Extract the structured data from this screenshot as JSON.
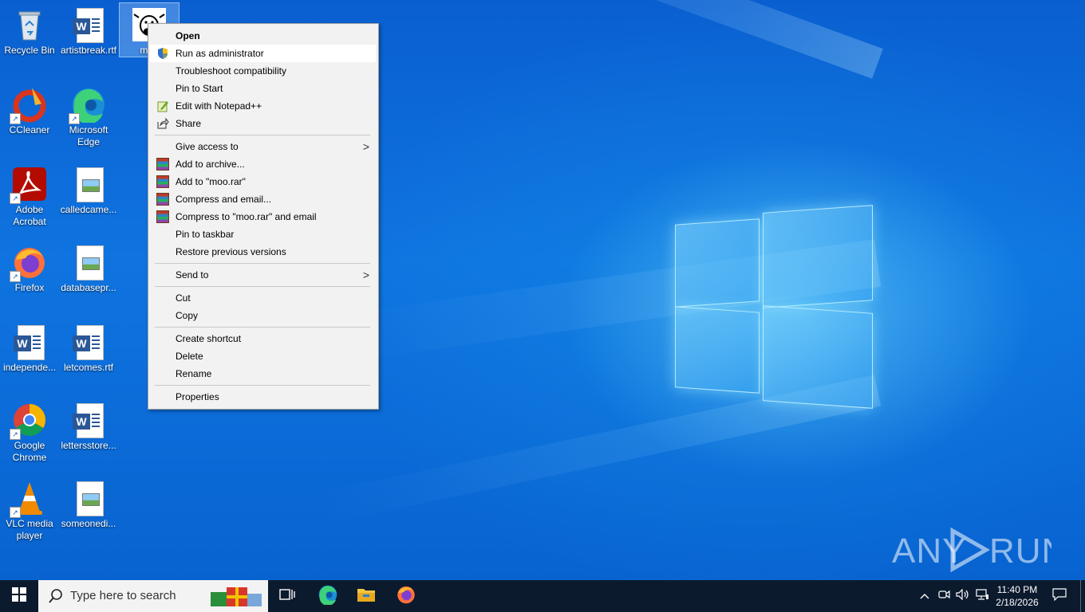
{
  "desktop": {
    "icons": [
      {
        "label": "Recycle Bin",
        "icon": "recycle-bin-icon"
      },
      {
        "label": "artistbreak.rtf",
        "icon": "word-document-icon"
      },
      {
        "label": "moo",
        "icon": "cow-executable-icon"
      },
      {
        "label": "CCleaner",
        "icon": "ccleaner-icon"
      },
      {
        "label": "Microsoft Edge",
        "icon": "edge-icon"
      },
      {
        "label": "Adobe Acrobat",
        "icon": "acrobat-icon"
      },
      {
        "label": "calledcame...",
        "icon": "image-document-icon"
      },
      {
        "label": "Firefox",
        "icon": "firefox-icon"
      },
      {
        "label": "databasepr...",
        "icon": "image-document-icon"
      },
      {
        "label": "independe...",
        "icon": "word-document-icon"
      },
      {
        "label": "letcomes.rtf",
        "icon": "word-document-icon"
      },
      {
        "label": "Google Chrome",
        "icon": "chrome-icon"
      },
      {
        "label": "lettersstore...",
        "icon": "word-document-icon"
      },
      {
        "label": "VLC media player",
        "icon": "vlc-icon"
      },
      {
        "label": "someonedi...",
        "icon": "image-document-icon"
      }
    ]
  },
  "context_menu": {
    "items": [
      {
        "label": "Open",
        "bold": true
      },
      {
        "label": "Run as administrator",
        "icon": "uac-shield-icon",
        "highlighted": true
      },
      {
        "label": "Troubleshoot compatibility"
      },
      {
        "label": "Pin to Start"
      },
      {
        "label": "Edit with Notepad++",
        "icon": "notepadpp-icon"
      },
      {
        "label": "Share",
        "icon": "share-icon"
      },
      {
        "label": "Give access to",
        "submenu": true
      },
      {
        "label": "Add to archive...",
        "icon": "winrar-icon"
      },
      {
        "label": "Add to \"moo.rar\"",
        "icon": "winrar-icon"
      },
      {
        "label": "Compress and email...",
        "icon": "winrar-icon"
      },
      {
        "label": "Compress to \"moo.rar\" and email",
        "icon": "winrar-icon"
      },
      {
        "label": "Pin to taskbar"
      },
      {
        "label": "Restore previous versions"
      },
      {
        "label": "Send to",
        "submenu": true
      },
      {
        "label": "Cut"
      },
      {
        "label": "Copy"
      },
      {
        "label": "Create shortcut"
      },
      {
        "label": "Delete"
      },
      {
        "label": "Rename"
      },
      {
        "label": "Properties"
      }
    ],
    "submenu_glyph": ">"
  },
  "taskbar": {
    "search_placeholder": "Type here to search",
    "clock_time": "11:40 PM",
    "clock_date": "2/18/2026",
    "pinned": [
      "task-view-icon",
      "edge-icon",
      "file-explorer-icon",
      "firefox-icon"
    ],
    "tray_chevron": "^"
  },
  "watermark": {
    "text": "ANY RUN"
  },
  "colors": {
    "accent": "#0078d7",
    "taskbar": "#0c1a2e",
    "menu_bg": "#f2f2f2"
  }
}
